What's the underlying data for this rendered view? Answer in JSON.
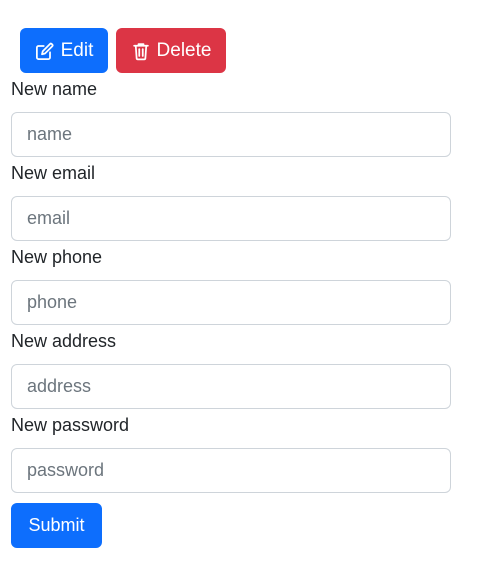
{
  "actions": {
    "edit_label": "Edit",
    "delete_label": "Delete",
    "edit_icon": "pencil-square-icon",
    "delete_icon": "trash-icon",
    "edit_color": "#0d6efd",
    "delete_color": "#dc3545"
  },
  "form": {
    "fields": [
      {
        "label": "New name",
        "placeholder": "name",
        "value": ""
      },
      {
        "label": "New email",
        "placeholder": "email",
        "value": ""
      },
      {
        "label": "New phone",
        "placeholder": "phone",
        "value": ""
      },
      {
        "label": "New address",
        "placeholder": "address",
        "value": ""
      },
      {
        "label": "New password",
        "placeholder": "password",
        "value": ""
      }
    ],
    "submit_label": "Submit",
    "submit_color": "#0d6efd"
  }
}
